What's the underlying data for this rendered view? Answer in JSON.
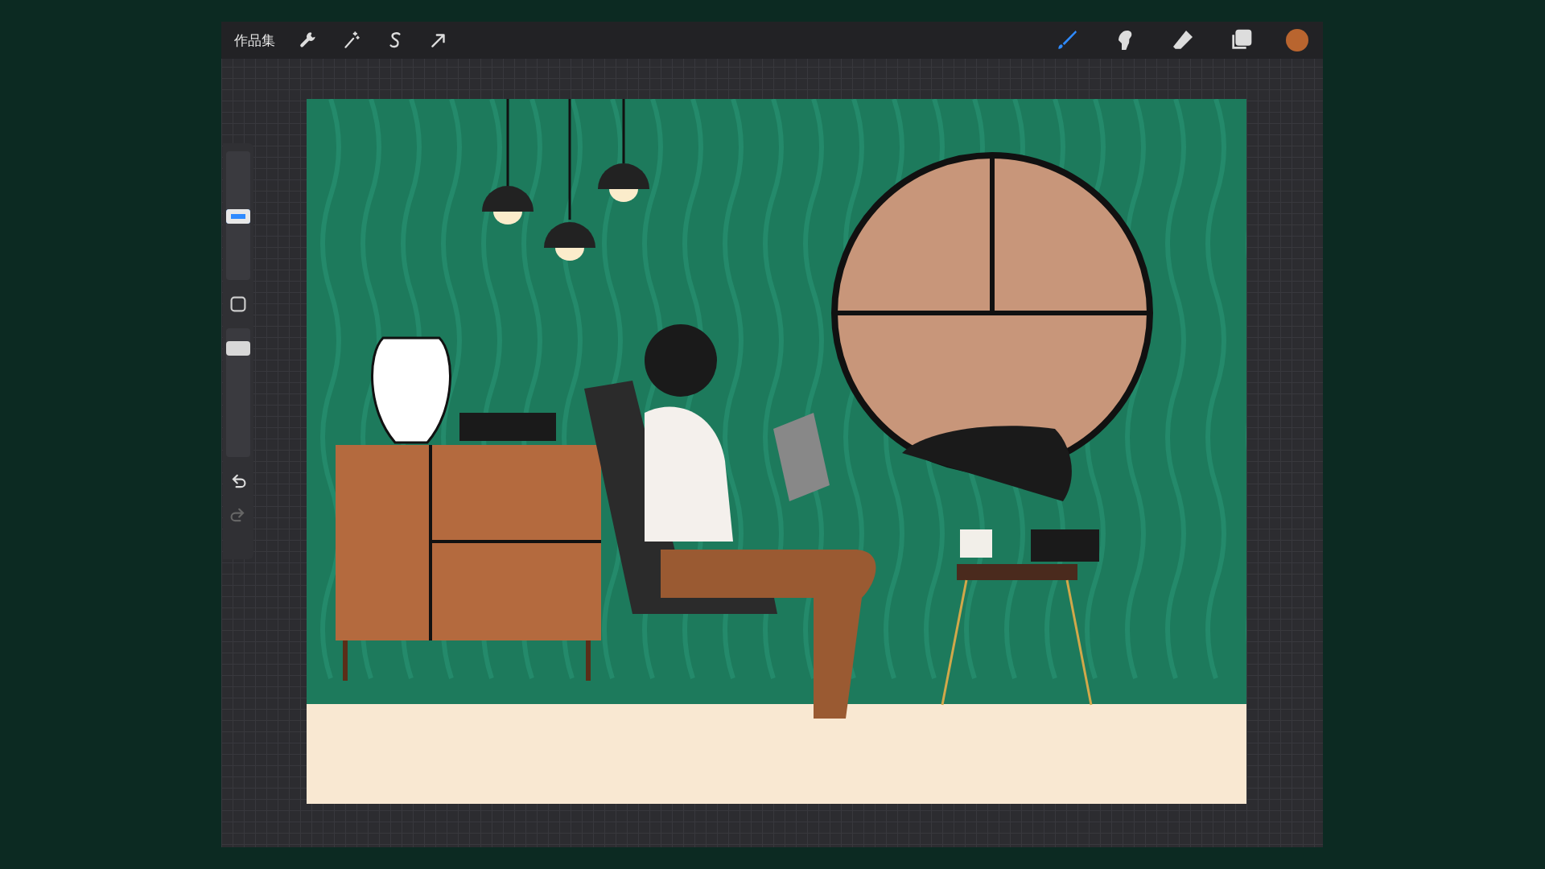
{
  "toolbar": {
    "gallery_label": "作品集",
    "actions": [
      {
        "kind": "wrench"
      },
      {
        "kind": "wand"
      },
      {
        "kind": "selection"
      },
      {
        "kind": "transform"
      }
    ],
    "tools": [
      {
        "kind": "brush",
        "selected": true
      },
      {
        "kind": "smudge",
        "selected": false
      },
      {
        "kind": "eraser",
        "selected": false
      },
      {
        "kind": "layers",
        "selected": false
      }
    ]
  },
  "sidebar": {
    "brush_size": {
      "level": 0.45
    },
    "opacity": {
      "level": 0.88
    },
    "redo": {
      "disabled": true
    }
  }
}
